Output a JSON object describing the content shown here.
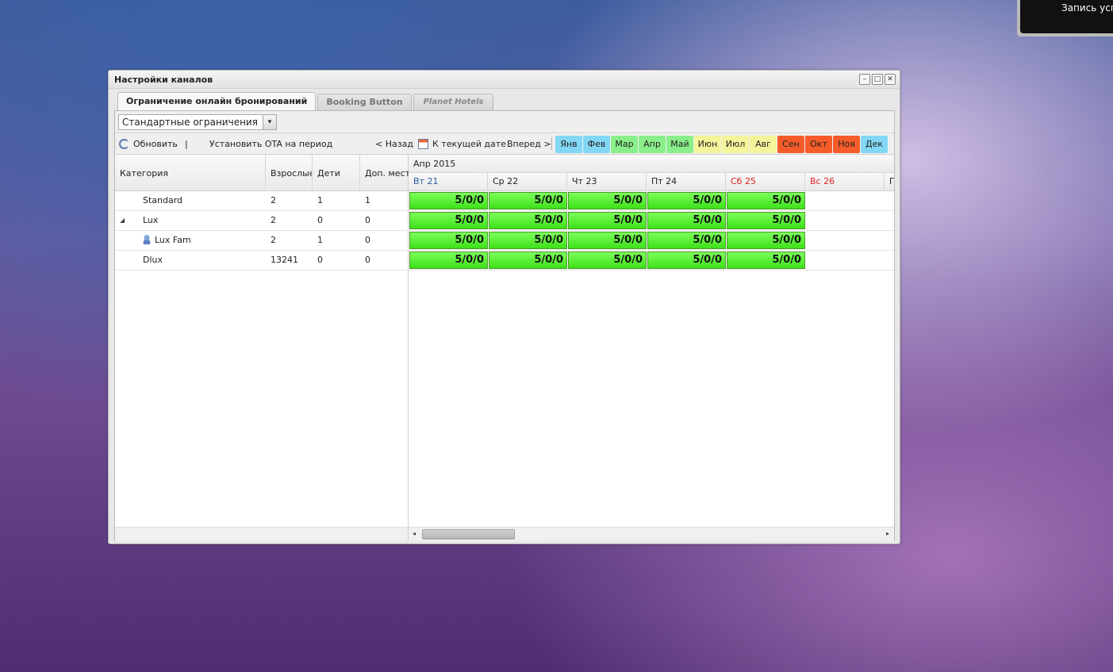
{
  "notification": {
    "text": "Запись успешно сохранена"
  },
  "window": {
    "title": "Настройки каналов",
    "tools": {
      "minimize": "–",
      "maximize": "□",
      "close": "✕"
    }
  },
  "tabs": [
    {
      "label": "Ограничение онлайн бронирований",
      "active": true
    },
    {
      "label": "Booking Button",
      "active": false
    },
    {
      "label": "Planet Hotels",
      "active": false
    }
  ],
  "restriction_select": {
    "value": "Стандартные ограничения",
    "arrow": "▾"
  },
  "toolbar": {
    "refresh": "Обновить",
    "separator": "|",
    "set_ota": "Установить OTA на период",
    "back": "< Назад",
    "today": "К текущей дате",
    "forward": "Вперед >"
  },
  "months": [
    {
      "label": "Янв",
      "color": "#82d7f5"
    },
    {
      "label": "Фев",
      "color": "#82d7f5"
    },
    {
      "label": "Мар",
      "color": "#8aef8a"
    },
    {
      "label": "Апр",
      "color": "#8aef8a"
    },
    {
      "label": "Май",
      "color": "#8aef8a"
    },
    {
      "label": "Июн",
      "color": "#f4f49a"
    },
    {
      "label": "Июл",
      "color": "#f4f49a"
    },
    {
      "label": "Авг",
      "color": "#f4f49a"
    },
    {
      "label": "Сен",
      "color": "#f55c2a"
    },
    {
      "label": "Окт",
      "color": "#f55c2a"
    },
    {
      "label": "Ноя",
      "color": "#f55c2a"
    },
    {
      "label": "Дек",
      "color": "#82d7f5"
    }
  ],
  "left_grid": {
    "headers": [
      "Категория",
      "Взрослые",
      "Дети",
      "Доп. мест"
    ],
    "rows": [
      {
        "category": "Standard",
        "adults": "2",
        "children": "1",
        "extra": "1"
      },
      {
        "category": "Lux",
        "adults": "2",
        "children": "0",
        "extra": "0",
        "expander": "◢"
      },
      {
        "category": "Lux Fam",
        "adults": "2",
        "children": "1",
        "extra": "0"
      },
      {
        "category": "Dlux",
        "adults": "13241",
        "children": "0",
        "extra": "0"
      }
    ]
  },
  "calendar": {
    "month": "Апр 2015",
    "days": [
      {
        "label": "Вт 21",
        "color": "#2a5aa0"
      },
      {
        "label": "Ср 22",
        "color": "#222222"
      },
      {
        "label": "Чт 23",
        "color": "#222222"
      },
      {
        "label": "Пт 24",
        "color": "#222222"
      },
      {
        "label": "Сб 25",
        "color": "#e02020"
      },
      {
        "label": "Вс 26",
        "color": "#e02020"
      },
      {
        "label": "П",
        "color": "#222222"
      }
    ],
    "availability": [
      [
        "5/0/0",
        "5/0/0",
        "5/0/0",
        "5/0/0",
        "5/0/0"
      ],
      [
        "5/0/0",
        "5/0/0",
        "5/0/0",
        "5/0/0",
        "5/0/0"
      ],
      [
        "5/0/0",
        "5/0/0",
        "5/0/0",
        "5/0/0",
        "5/0/0"
      ],
      [
        "5/0/0",
        "5/0/0",
        "5/0/0",
        "5/0/0",
        "5/0/0"
      ]
    ]
  },
  "scrollbar": {
    "left": "◂",
    "right": "▸"
  }
}
